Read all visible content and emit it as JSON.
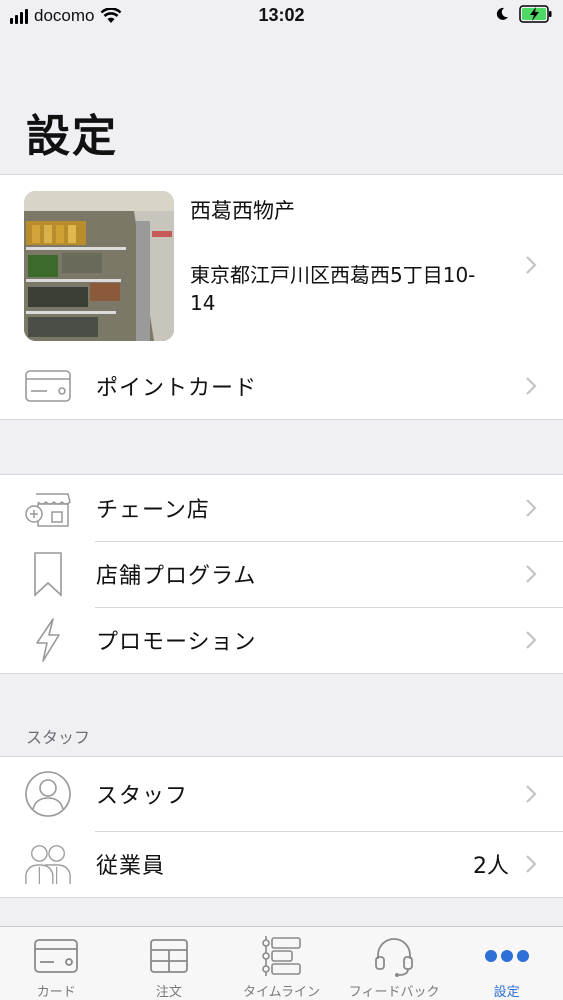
{
  "status": {
    "carrier": "docomo",
    "time": "13:02"
  },
  "page": {
    "title": "設定"
  },
  "store": {
    "name": "西葛西物产",
    "address": "東京都江戸川区西葛西5丁目10-14"
  },
  "menu": {
    "point_card": "ポイントカード",
    "chain_store": "チェーン店",
    "store_program": "店舗プログラム",
    "promotion": "プロモーション"
  },
  "staff_section": {
    "header": "スタッフ",
    "staff": "スタッフ",
    "employees": "従業員",
    "employee_count": "2人"
  },
  "tabs": [
    {
      "label": "カード",
      "icon": "card-icon"
    },
    {
      "label": "注文",
      "icon": "table-icon"
    },
    {
      "label": "タイムライン",
      "icon": "timeline-icon"
    },
    {
      "label": "フィードバック",
      "icon": "headset-icon"
    },
    {
      "label": "設定",
      "icon": "more-dots-icon",
      "active": true
    }
  ],
  "colors": {
    "accent": "#2c6fd6",
    "background": "#efeff4",
    "separator": "#d6d6da"
  }
}
